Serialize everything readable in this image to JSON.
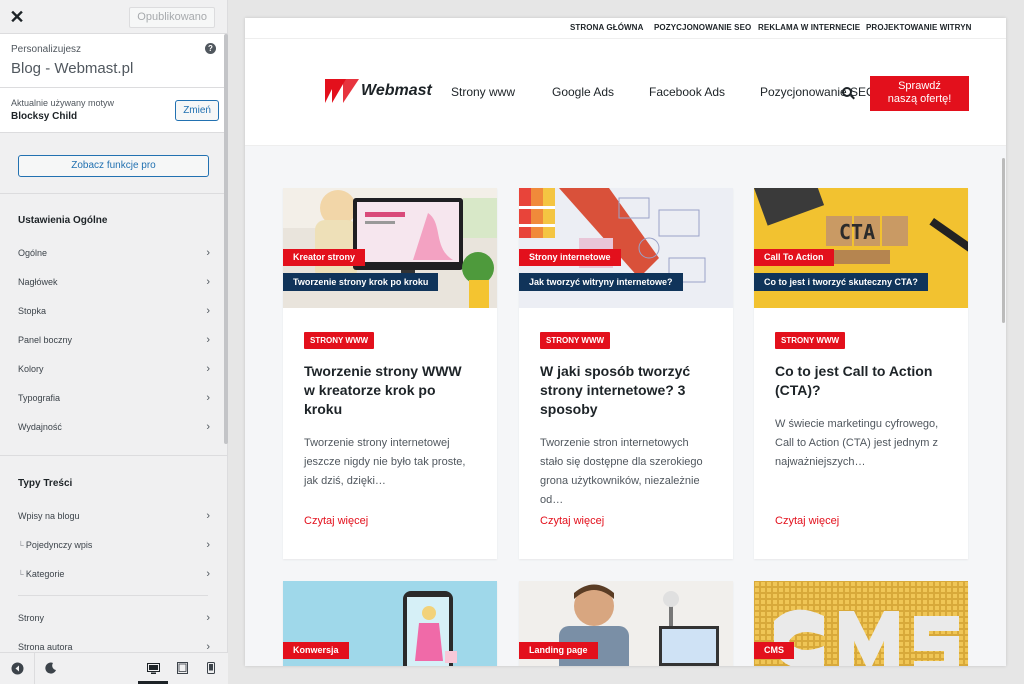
{
  "customizer": {
    "close_icon": "close-icon",
    "publish_label": "Opublikowano",
    "personalizing_label": "Personalizujesz",
    "site_title": "Blog - Webmast.pl",
    "theme_label": "Aktualnie używany motyw",
    "theme_name": "Blocksy Child",
    "change_label": "Zmień",
    "pro_label": "Zobacz funkcje pro",
    "general_section": "Ustawienia Ogólne",
    "general_items": [
      "Ogólne",
      "Nagłówek",
      "Stopka",
      "Panel boczny",
      "Kolory",
      "Typografia",
      "Wydajność"
    ],
    "content_section": "Typy Treści",
    "content_items": [
      "Wpisy na blogu",
      "Pojedynczy wpis",
      "Kategorie"
    ],
    "page_items": [
      "Strony",
      "Strona autora"
    ]
  },
  "site": {
    "top_links": [
      "STRONA GŁÓWNA",
      "POZYCJONOWANIE SEO",
      "REKLAMA W INTERNECIE",
      "PROJEKTOWANIE WITRYN"
    ],
    "logo_text": "Webmast",
    "nav": [
      "Strony www",
      "Google Ads",
      "Facebook Ads",
      "Pozycjonowanie SEO"
    ],
    "cta_line1": "Sprawdź",
    "cta_line2": "naszą ofertę!",
    "accent": "#e3101c",
    "navy": "#10345a"
  },
  "posts": [
    {
      "cat": "Kreator strony",
      "img_title": "Tworzenie strony krok po kroku",
      "badge": "STRONY WWW",
      "title": "Tworzenie strony WWW w kreatorze krok po kroku",
      "excerpt": "Tworzenie strony internetowej jeszcze nigdy nie było tak proste, jak dziś, dzięki…",
      "more": "Czytaj więcej"
    },
    {
      "cat": "Strony internetowe",
      "img_title": "Jak tworzyć witryny internetowe?",
      "badge": "STRONY WWW",
      "title": "W jaki sposób tworzyć strony internetowe? 3 sposoby",
      "excerpt": "Tworzenie stron internetowych stało się dostępne dla szerokiego grona użytkowników, niezależnie od…",
      "more": "Czytaj więcej"
    },
    {
      "cat": "Call To Action",
      "img_title": "Co to jest i tworzyć skuteczny CTA?",
      "badge": "STRONY WWW",
      "title": "Co to jest Call to Action (CTA)?",
      "excerpt": "W świecie marketingu cyfrowego, Call to Action (CTA) jest jednym z najważniejszych…",
      "more": "Czytaj więcej",
      "img_text": "CTA"
    },
    {
      "cat": "Konwersja"
    },
    {
      "cat": "Landing page"
    },
    {
      "cat": "CMS"
    }
  ]
}
